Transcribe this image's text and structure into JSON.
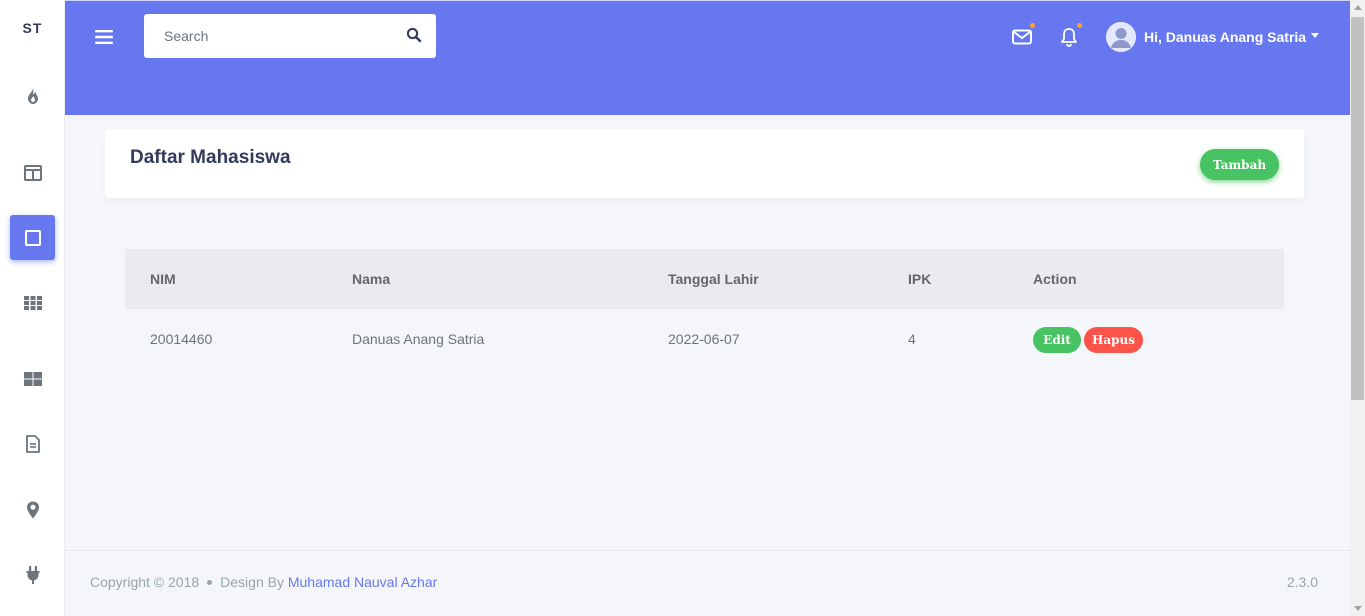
{
  "sidebar": {
    "brand": "ST",
    "items": [
      {
        "icon": "fire-icon"
      },
      {
        "icon": "columns-icon"
      },
      {
        "icon": "square-icon",
        "active": true
      },
      {
        "icon": "grid-icon"
      },
      {
        "icon": "dashboard-icon"
      },
      {
        "icon": "file-icon"
      },
      {
        "icon": "map-marker-icon"
      },
      {
        "icon": "plug-icon"
      }
    ]
  },
  "topbar": {
    "search_placeholder": "Search",
    "user_name": "Hi, Danuas Anang Satria",
    "accent_color": "#6777ef",
    "notification_dot_color": "#ffa426"
  },
  "header": {
    "title": "Daftar Mahasiswa",
    "add_button": "Tambah"
  },
  "table": {
    "headers": [
      "NIM",
      "Nama",
      "Tanggal Lahir",
      "IPK",
      "Action"
    ],
    "rows": [
      {
        "nim": "20014460",
        "nama": "Danuas Anang Satria",
        "tanggal_lahir": "2022-06-07",
        "ipk": "4",
        "edit_label": "Edit",
        "delete_label": "Hapus"
      }
    ]
  },
  "footer": {
    "copyright": "Copyright © 2018",
    "design_by": "Design By",
    "author": "Muhamad Nauval Azhar",
    "version": "2.3.0"
  }
}
